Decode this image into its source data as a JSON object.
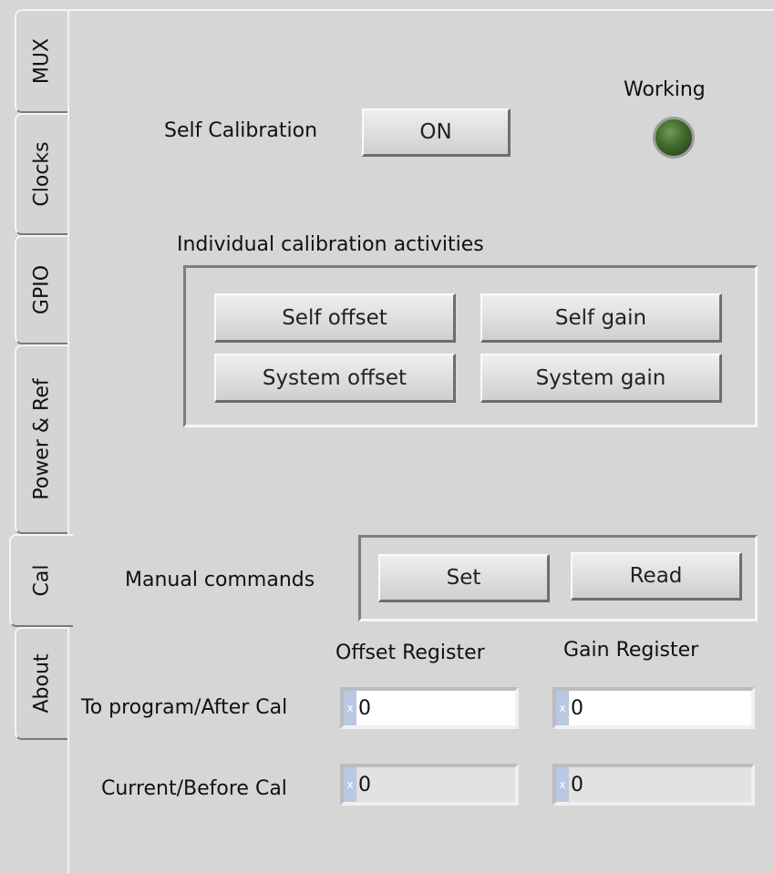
{
  "tabs": [
    {
      "label": "MUX"
    },
    {
      "label": "Clocks"
    },
    {
      "label": "GPIO"
    },
    {
      "label": "Power & Ref"
    },
    {
      "label": "Cal"
    },
    {
      "label": "About"
    }
  ],
  "active_tab": "Cal",
  "self_calibration": {
    "label": "Self Calibration",
    "button": "ON"
  },
  "working": {
    "label": "Working",
    "led_color": "#3f6a2a"
  },
  "individual": {
    "heading": "Individual calibration activities",
    "buttons": [
      "Self offset",
      "Self gain",
      "System offset",
      "System gain"
    ]
  },
  "manual": {
    "label": "Manual commands",
    "set": "Set",
    "read": "Read"
  },
  "registers": {
    "offset_header": "Offset Register",
    "gain_header": "Gain Register",
    "rows": [
      {
        "label": "To program/After Cal",
        "offset": "0",
        "gain": "0",
        "radix": "x"
      },
      {
        "label": "Current/Before Cal",
        "offset": "0",
        "gain": "0",
        "radix": "x"
      }
    ]
  }
}
